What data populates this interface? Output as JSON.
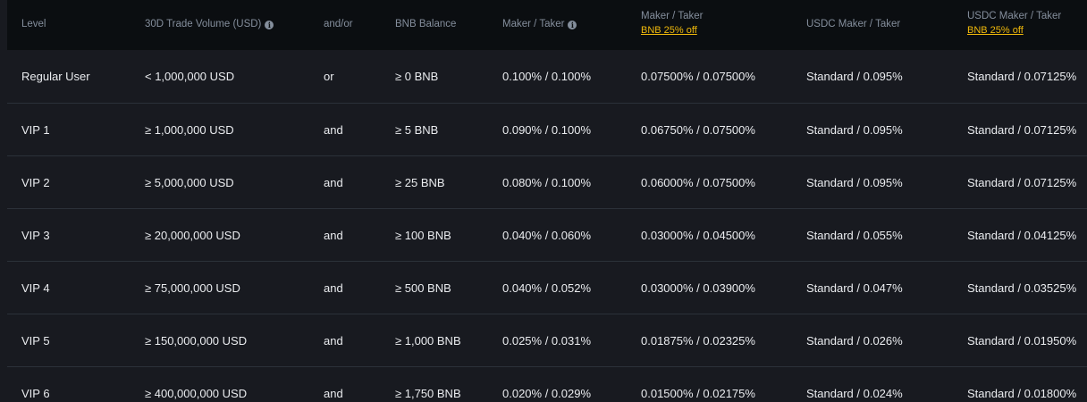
{
  "header": {
    "level": "Level",
    "volume": "30D Trade Volume (USD)",
    "andor": "and/or",
    "bnb_balance": "BNB Balance",
    "maker_taker": "Maker / Taker",
    "maker_taker_bnb": "Maker / Taker",
    "maker_taker_bnb_sub": "BNB 25% off",
    "usdc_maker_taker": "USDC Maker / Taker",
    "usdc_maker_taker_bnb": "USDC Maker / Taker",
    "usdc_maker_taker_bnb_sub": "BNB 25% off",
    "info_icon": "info-icon",
    "accent_color": "#f0b90b"
  },
  "rows": [
    {
      "level": "Regular User",
      "volume": "< 1,000,000 USD",
      "andor": "or",
      "bnb": "≥ 0 BNB",
      "mt": "0.100% / 0.100%",
      "mt_bnb": "0.07500% / 0.07500%",
      "usdc": "Standard / 0.095%",
      "usdc_bnb": "Standard / 0.07125%"
    },
    {
      "level": "VIP 1",
      "volume": "≥ 1,000,000 USD",
      "andor": "and",
      "bnb": "≥ 5 BNB",
      "mt": "0.090% / 0.100%",
      "mt_bnb": "0.06750% / 0.07500%",
      "usdc": "Standard / 0.095%",
      "usdc_bnb": "Standard / 0.07125%"
    },
    {
      "level": "VIP 2",
      "volume": "≥ 5,000,000 USD",
      "andor": "and",
      "bnb": "≥ 25 BNB",
      "mt": "0.080% / 0.100%",
      "mt_bnb": "0.06000% / 0.07500%",
      "usdc": "Standard / 0.095%",
      "usdc_bnb": "Standard / 0.07125%"
    },
    {
      "level": "VIP 3",
      "volume": "≥ 20,000,000 USD",
      "andor": "and",
      "bnb": "≥ 100 BNB",
      "mt": "0.040% / 0.060%",
      "mt_bnb": "0.03000% / 0.04500%",
      "usdc": "Standard / 0.055%",
      "usdc_bnb": "Standard / 0.04125%"
    },
    {
      "level": "VIP 4",
      "volume": "≥ 75,000,000 USD",
      "andor": "and",
      "bnb": "≥ 500 BNB",
      "mt": "0.040% / 0.052%",
      "mt_bnb": "0.03000% / 0.03900%",
      "usdc": "Standard / 0.047%",
      "usdc_bnb": "Standard / 0.03525%"
    },
    {
      "level": "VIP 5",
      "volume": "≥ 150,000,000 USD",
      "andor": "and",
      "bnb": "≥ 1,000 BNB",
      "mt": "0.025% / 0.031%",
      "mt_bnb": "0.01875% / 0.02325%",
      "usdc": "Standard / 0.026%",
      "usdc_bnb": "Standard / 0.01950%"
    },
    {
      "level": "VIP 6",
      "volume": "≥ 400,000,000 USD",
      "andor": "and",
      "bnb": "≥ 1,750 BNB",
      "mt": "0.020% / 0.029%",
      "mt_bnb": "0.01500% / 0.02175%",
      "usdc": "Standard / 0.024%",
      "usdc_bnb": "Standard / 0.01800%"
    }
  ]
}
